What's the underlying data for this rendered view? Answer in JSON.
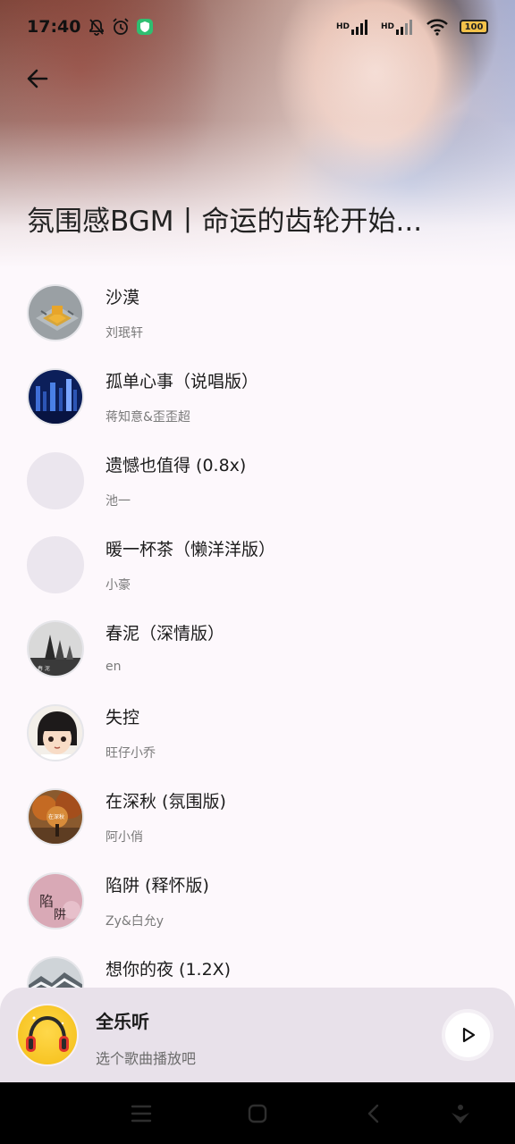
{
  "status_bar": {
    "time": "17:40",
    "network_1": "HD",
    "network_2": "HD",
    "battery": "100"
  },
  "header": {
    "title": "氛围感BGM丨命运的齿轮开始..."
  },
  "songs": [
    {
      "name": "沙漠",
      "artist": "刘珉轩",
      "cover": "maze-art"
    },
    {
      "name": "孤单心事（说唱版）",
      "artist": "蒋知意&歪歪超",
      "cover": "night-city"
    },
    {
      "name": "遗憾也值得 (0.8x)",
      "artist": "池一",
      "cover": "placeholder"
    },
    {
      "name": "暖一杯茶（懒洋洋版）",
      "artist": "小豪",
      "cover": "placeholder"
    },
    {
      "name": "春泥（深情版）",
      "artist": "en",
      "cover": "misty-trees"
    },
    {
      "name": "失控",
      "artist": "旺仔小乔",
      "cover": "anime-girl"
    },
    {
      "name": "在深秋 (氛围版)",
      "artist": "阿小俏",
      "cover": "autumn-forest"
    },
    {
      "name": "陷阱 (释怀版)",
      "artist": "Zy&白允y",
      "cover": "pink-calligraphy"
    },
    {
      "name": "想你的夜 (1.2X)",
      "artist": "",
      "cover": "snow-scene"
    }
  ],
  "player": {
    "title": "全乐听",
    "subtitle": "选个歌曲播放吧"
  },
  "colors": {
    "background": "#fdf8fc",
    "player_bg": "#e8e1ea",
    "player_cover": "#f7c525",
    "headphone_red": "#e0352b"
  },
  "icons": {
    "back": "back-arrow-icon",
    "play": "play-icon",
    "nav": [
      "menu-icon",
      "home-icon",
      "back-icon",
      "assistant-icon"
    ]
  }
}
